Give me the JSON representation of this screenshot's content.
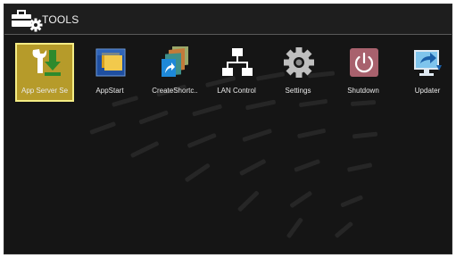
{
  "header": {
    "title": "TOOLS",
    "icon": "toolbox-gear-icon"
  },
  "apps": [
    {
      "label": "App Server Se",
      "icon": "wrench-download-icon",
      "selected": true
    },
    {
      "label": "AppStart",
      "icon": "appstart-icon",
      "selected": false
    },
    {
      "label": "CreateShortc..",
      "icon": "create-shortcut-icon",
      "selected": false
    },
    {
      "label": "LAN Control",
      "icon": "lan-network-icon",
      "selected": false
    },
    {
      "label": "Settings",
      "icon": "gear-icon",
      "selected": false
    },
    {
      "label": "Shutdown",
      "icon": "power-icon",
      "selected": false
    },
    {
      "label": "Updater",
      "icon": "updater-icon",
      "selected": false
    }
  ],
  "colors": {
    "background": "#151515",
    "selection": "#b69b2a",
    "selection_border": "#f4ec84",
    "text": "#eaeaea"
  }
}
